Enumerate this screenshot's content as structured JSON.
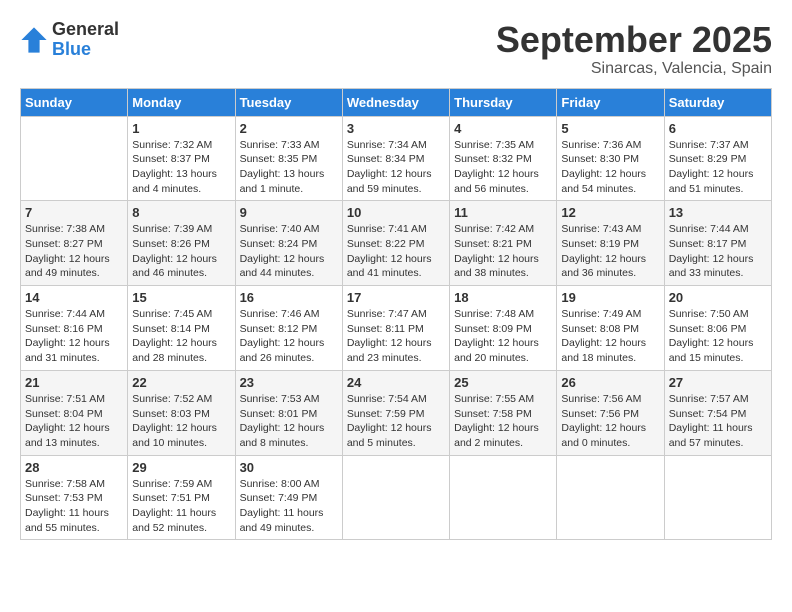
{
  "header": {
    "logo_general": "General",
    "logo_blue": "Blue",
    "month": "September 2025",
    "location": "Sinarcas, Valencia, Spain"
  },
  "days_of_week": [
    "Sunday",
    "Monday",
    "Tuesday",
    "Wednesday",
    "Thursday",
    "Friday",
    "Saturday"
  ],
  "weeks": [
    [
      {
        "day": "",
        "info": ""
      },
      {
        "day": "1",
        "info": "Sunrise: 7:32 AM\nSunset: 8:37 PM\nDaylight: 13 hours\nand 4 minutes."
      },
      {
        "day": "2",
        "info": "Sunrise: 7:33 AM\nSunset: 8:35 PM\nDaylight: 13 hours\nand 1 minute."
      },
      {
        "day": "3",
        "info": "Sunrise: 7:34 AM\nSunset: 8:34 PM\nDaylight: 12 hours\nand 59 minutes."
      },
      {
        "day": "4",
        "info": "Sunrise: 7:35 AM\nSunset: 8:32 PM\nDaylight: 12 hours\nand 56 minutes."
      },
      {
        "day": "5",
        "info": "Sunrise: 7:36 AM\nSunset: 8:30 PM\nDaylight: 12 hours\nand 54 minutes."
      },
      {
        "day": "6",
        "info": "Sunrise: 7:37 AM\nSunset: 8:29 PM\nDaylight: 12 hours\nand 51 minutes."
      }
    ],
    [
      {
        "day": "7",
        "info": "Sunrise: 7:38 AM\nSunset: 8:27 PM\nDaylight: 12 hours\nand 49 minutes."
      },
      {
        "day": "8",
        "info": "Sunrise: 7:39 AM\nSunset: 8:26 PM\nDaylight: 12 hours\nand 46 minutes."
      },
      {
        "day": "9",
        "info": "Sunrise: 7:40 AM\nSunset: 8:24 PM\nDaylight: 12 hours\nand 44 minutes."
      },
      {
        "day": "10",
        "info": "Sunrise: 7:41 AM\nSunset: 8:22 PM\nDaylight: 12 hours\nand 41 minutes."
      },
      {
        "day": "11",
        "info": "Sunrise: 7:42 AM\nSunset: 8:21 PM\nDaylight: 12 hours\nand 38 minutes."
      },
      {
        "day": "12",
        "info": "Sunrise: 7:43 AM\nSunset: 8:19 PM\nDaylight: 12 hours\nand 36 minutes."
      },
      {
        "day": "13",
        "info": "Sunrise: 7:44 AM\nSunset: 8:17 PM\nDaylight: 12 hours\nand 33 minutes."
      }
    ],
    [
      {
        "day": "14",
        "info": "Sunrise: 7:44 AM\nSunset: 8:16 PM\nDaylight: 12 hours\nand 31 minutes."
      },
      {
        "day": "15",
        "info": "Sunrise: 7:45 AM\nSunset: 8:14 PM\nDaylight: 12 hours\nand 28 minutes."
      },
      {
        "day": "16",
        "info": "Sunrise: 7:46 AM\nSunset: 8:12 PM\nDaylight: 12 hours\nand 26 minutes."
      },
      {
        "day": "17",
        "info": "Sunrise: 7:47 AM\nSunset: 8:11 PM\nDaylight: 12 hours\nand 23 minutes."
      },
      {
        "day": "18",
        "info": "Sunrise: 7:48 AM\nSunset: 8:09 PM\nDaylight: 12 hours\nand 20 minutes."
      },
      {
        "day": "19",
        "info": "Sunrise: 7:49 AM\nSunset: 8:08 PM\nDaylight: 12 hours\nand 18 minutes."
      },
      {
        "day": "20",
        "info": "Sunrise: 7:50 AM\nSunset: 8:06 PM\nDaylight: 12 hours\nand 15 minutes."
      }
    ],
    [
      {
        "day": "21",
        "info": "Sunrise: 7:51 AM\nSunset: 8:04 PM\nDaylight: 12 hours\nand 13 minutes."
      },
      {
        "day": "22",
        "info": "Sunrise: 7:52 AM\nSunset: 8:03 PM\nDaylight: 12 hours\nand 10 minutes."
      },
      {
        "day": "23",
        "info": "Sunrise: 7:53 AM\nSunset: 8:01 PM\nDaylight: 12 hours\nand 8 minutes."
      },
      {
        "day": "24",
        "info": "Sunrise: 7:54 AM\nSunset: 7:59 PM\nDaylight: 12 hours\nand 5 minutes."
      },
      {
        "day": "25",
        "info": "Sunrise: 7:55 AM\nSunset: 7:58 PM\nDaylight: 12 hours\nand 2 minutes."
      },
      {
        "day": "26",
        "info": "Sunrise: 7:56 AM\nSunset: 7:56 PM\nDaylight: 12 hours\nand 0 minutes."
      },
      {
        "day": "27",
        "info": "Sunrise: 7:57 AM\nSunset: 7:54 PM\nDaylight: 11 hours\nand 57 minutes."
      }
    ],
    [
      {
        "day": "28",
        "info": "Sunrise: 7:58 AM\nSunset: 7:53 PM\nDaylight: 11 hours\nand 55 minutes."
      },
      {
        "day": "29",
        "info": "Sunrise: 7:59 AM\nSunset: 7:51 PM\nDaylight: 11 hours\nand 52 minutes."
      },
      {
        "day": "30",
        "info": "Sunrise: 8:00 AM\nSunset: 7:49 PM\nDaylight: 11 hours\nand 49 minutes."
      },
      {
        "day": "",
        "info": ""
      },
      {
        "day": "",
        "info": ""
      },
      {
        "day": "",
        "info": ""
      },
      {
        "day": "",
        "info": ""
      }
    ]
  ]
}
